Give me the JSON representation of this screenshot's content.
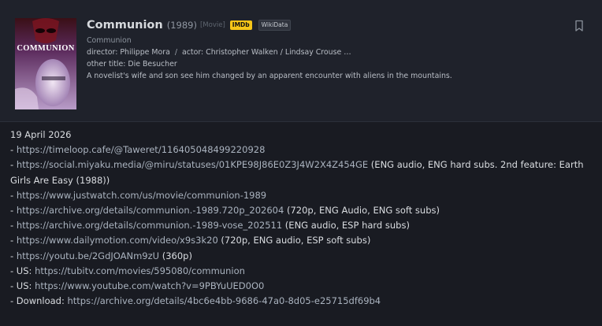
{
  "movie": {
    "title": "Communion",
    "year": "(1989)",
    "type": "[Movie]",
    "imdb_badge": "IMDb",
    "wikidata_badge": "WikiData",
    "subtitle": "Communion",
    "director": "director: Philippe Mora",
    "separator": "/",
    "actors": "actor: Christopher Walken / Lindsay Crouse …",
    "other_title": "other title: Die Besucher",
    "description": "A novelist's wife and son see him changed by an apparent encounter with aliens in the mountains.",
    "poster_text": "COMMUNION",
    "bookmark_icon": "bookmark-icon"
  },
  "post": {
    "date": "19 April 2026",
    "rows": [
      {
        "prefix": "- ",
        "link": "https://timeloop.cafe/@Taweret/116405048499220928",
        "suffix": ""
      },
      {
        "prefix": "- ",
        "link": "https://social.miyaku.media/@miru/statuses/01KPE98J86E0Z3J4W2X4Z454GE",
        "suffix": " (ENG audio, ENG hard subs. 2nd feature: Earth Girls Are Easy (1988))"
      },
      {
        "prefix": "- ",
        "link": "https://www.justwatch.com/us/movie/communion-1989",
        "suffix": ""
      },
      {
        "prefix": "- ",
        "link": "https://archive.org/details/communion.-1989.720p_202604",
        "suffix": " (720p, ENG Audio, ENG soft subs)"
      },
      {
        "prefix": "- ",
        "link": "https://archive.org/details/communion.-1989-vose_202511",
        "suffix": " (ENG audio, ESP hard subs)"
      },
      {
        "prefix": "- ",
        "link": "https://www.dailymotion.com/video/x9s3k20",
        "suffix": " (720p, ENG audio, ESP soft subs)"
      },
      {
        "prefix": "- ",
        "link": "https://youtu.be/2GdJOANm9zU",
        "suffix": " (360p)"
      },
      {
        "prefix": "- US: ",
        "link": "https://tubitv.com/movies/595080/communion",
        "suffix": ""
      },
      {
        "prefix": "- US: ",
        "link": "https://www.youtube.com/watch?v=9PBYuUED0O0",
        "suffix": ""
      },
      {
        "prefix": "- Download: ",
        "link": "https://archive.org/details/4bc6e4bb-9686-47a0-8d05-e25715df69b4",
        "suffix": ""
      }
    ]
  }
}
